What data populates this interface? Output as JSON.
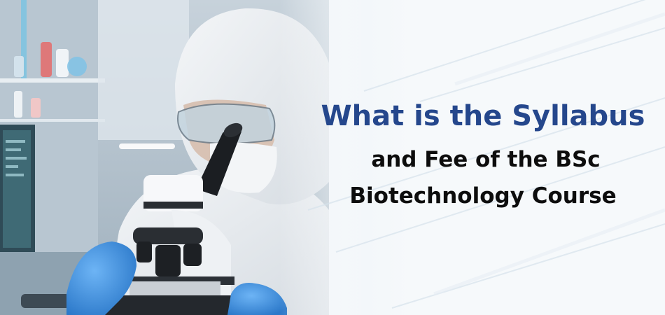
{
  "headline": {
    "line1": "What is the Syllabus",
    "line2": "and Fee of the BSc",
    "line3": "Biotechnology Course"
  },
  "colors": {
    "title_accent": "#25478c",
    "title_dark": "#0d0d0d",
    "glove_blue": "#3a8fe0",
    "background": "#eef3f7"
  },
  "photo": {
    "subject": "scientist-in-protective-suit-using-microscope",
    "icons": [
      "microscope-icon",
      "lab-monitor",
      "glassware-shelf"
    ]
  }
}
